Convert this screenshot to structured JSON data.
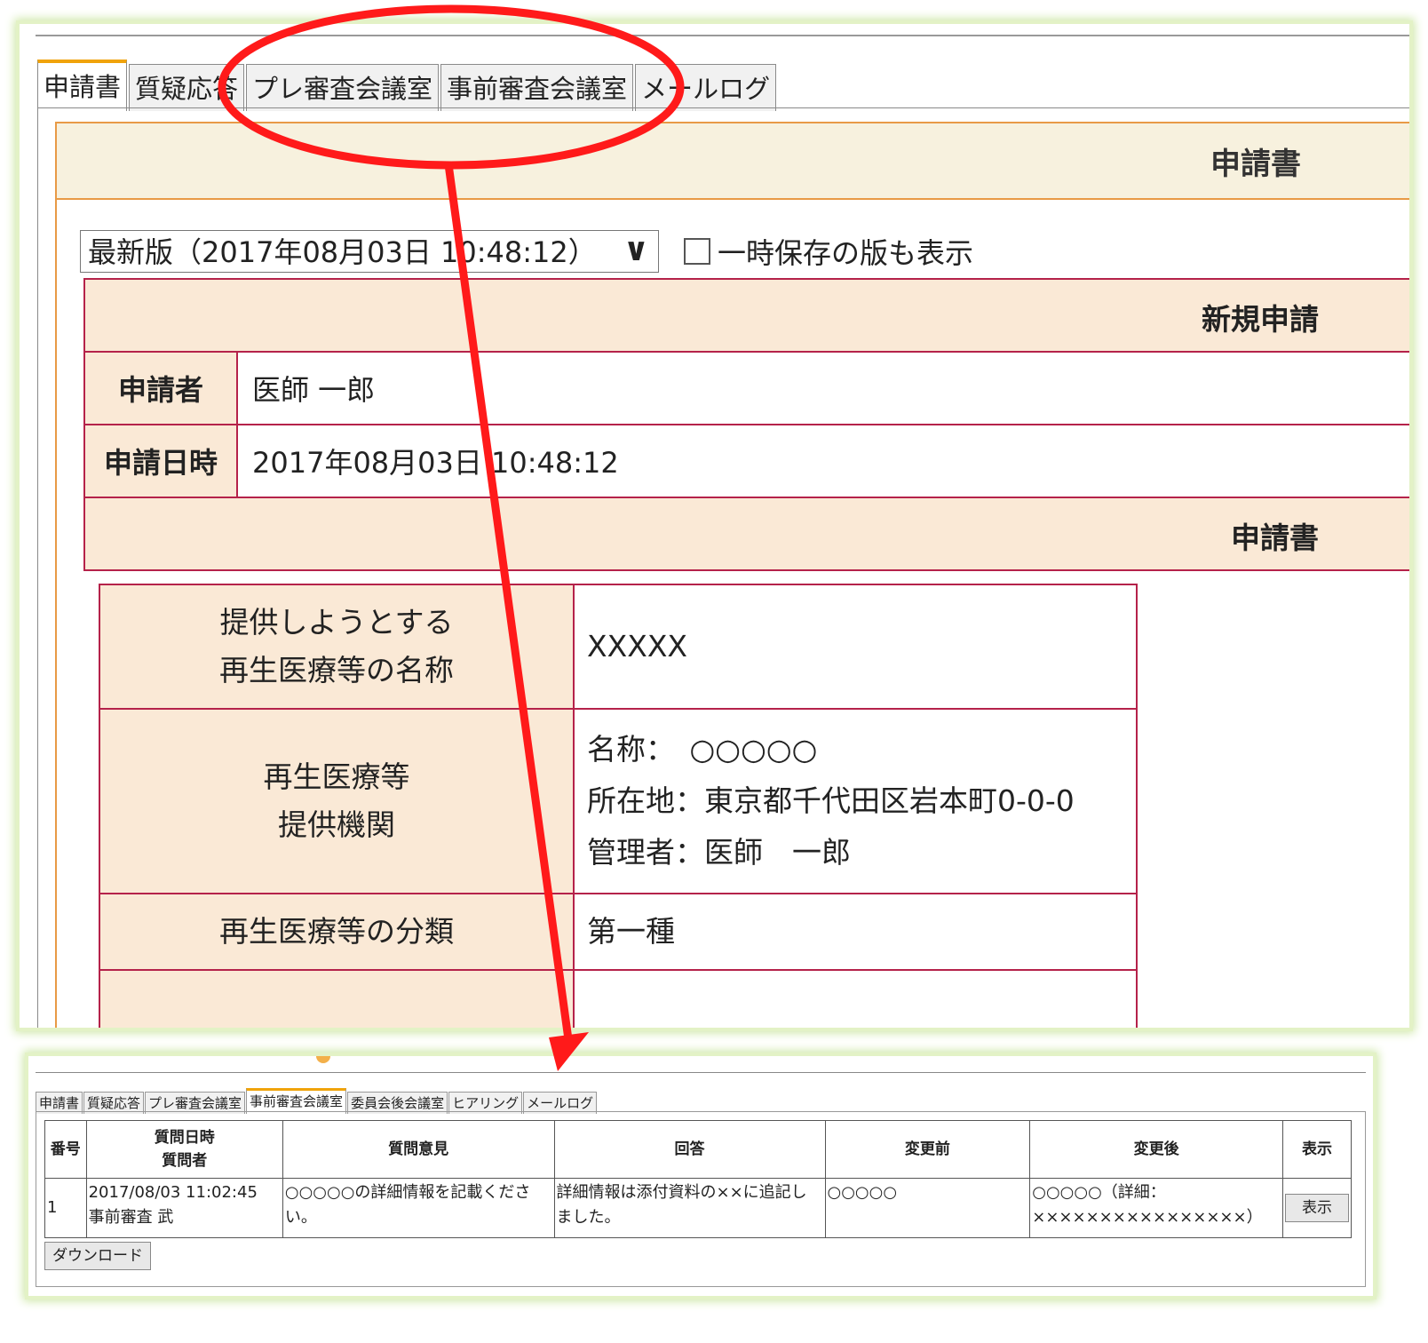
{
  "top": {
    "tabs": [
      "申請書",
      "質疑応答",
      "プレ審査会議室",
      "事前審査会議室",
      "メールログ"
    ],
    "active_tab": 0,
    "doc_header": "申請書",
    "version_select": "最新版（2017年08月03日 10:48:12）",
    "show_temp_label": "一時保存の版も表示",
    "section_new": "新規申請",
    "applicant_label": "申請者",
    "applicant_value": "医師 一郎",
    "date_label": "申請日時",
    "date_value": "2017年08月03日 10:48:12",
    "section_form": "申請書",
    "rows": [
      {
        "label_lines": [
          "提供しようとする",
          "再生医療等の名称"
        ],
        "value_lines": [
          "XXXXX"
        ]
      },
      {
        "label_lines": [
          "再生医療等",
          "提供機関"
        ],
        "value_lines": [
          "名称：　○○○○○",
          "所在地：東京都千代田区岩本町0-0-0",
          "管理者：医師　一郎"
        ]
      },
      {
        "label_lines": [
          "再生医療等の分類"
        ],
        "value_lines": [
          "第一種"
        ]
      }
    ]
  },
  "bottom": {
    "tabs": [
      "申請書",
      "質疑応答",
      "プレ審査会議室",
      "事前審査会議室",
      "委員会後会議室",
      "ヒアリング",
      "メールログ"
    ],
    "active_tab": 3,
    "headers": {
      "no": "番号",
      "datetime": [
        "質問日時",
        "質問者"
      ],
      "question": "質問意見",
      "answer": "回答",
      "before": "変更前",
      "after": "変更後",
      "show": "表示"
    },
    "row": {
      "no": "1",
      "datetime": "2017/08/03 11:02:45",
      "asker": "事前審査 武",
      "question": "○○○○○の詳細情報を記載ください。",
      "answer": "詳細情報は添付資料の××に追記しました。",
      "before": "○○○○○",
      "after": "○○○○○（詳細：××××××××××××××××）",
      "show_button": "表示"
    },
    "download_button": "ダウンロード"
  },
  "colors": {
    "highlight": "#ff1a1a",
    "tab_active": "#f0a30a",
    "table_border": "#b5224a",
    "label_bg": "#fae9d6",
    "panel_glow": "#cfe8a8"
  }
}
